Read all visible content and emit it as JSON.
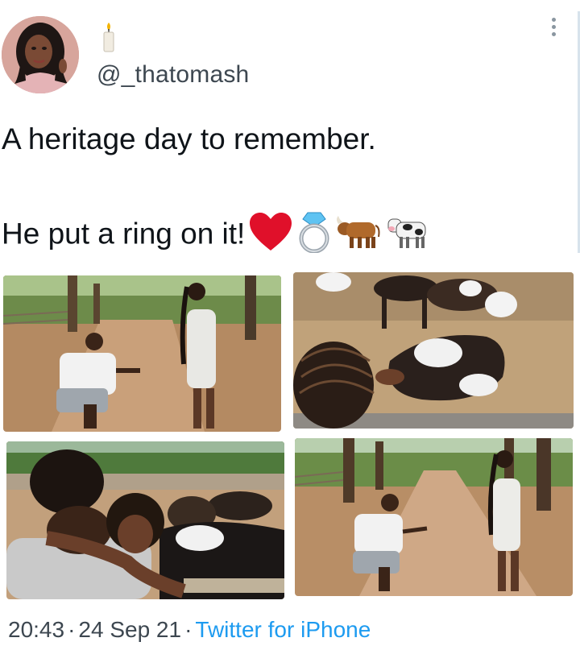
{
  "user": {
    "handle": "@_thatomash",
    "display_name_emoji": "candle-icon"
  },
  "tweet": {
    "line1": "A heritage day to remember.",
    "line2": "He put a ring on it!",
    "emojis": [
      "red-heart-icon",
      "ring-icon",
      "ox-icon",
      "cow-icon"
    ]
  },
  "media": {
    "photos": [
      "photo-proposal-path",
      "photo-cow-closeup",
      "photo-embrace-cows",
      "photo-proposal-wide"
    ]
  },
  "footer": {
    "time": "20:43",
    "date": "24 Sep 21",
    "separator": "·",
    "source": "Twitter for iPhone"
  },
  "colors": {
    "text": "#0f1419",
    "secondary": "#3d4750",
    "link": "#1d9bf0"
  }
}
